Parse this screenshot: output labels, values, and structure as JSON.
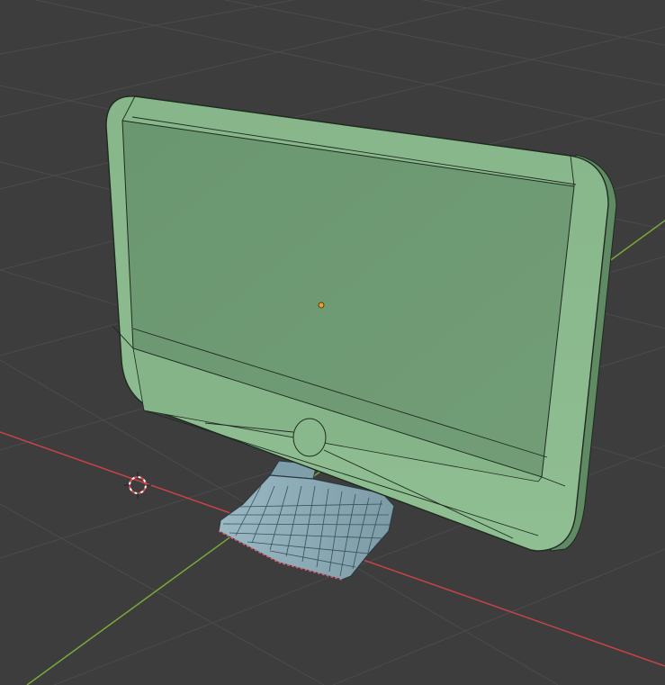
{
  "editor": "3d-viewport",
  "scene": {
    "objects": [
      {
        "name": "monitor-screen",
        "selected": true,
        "highlight_color": "#6e9a72",
        "edge_color": "#1e2a1f"
      },
      {
        "name": "monitor-stand",
        "selected": false,
        "face_color": "#8aa9b4",
        "seam_color": "#e05a6a"
      }
    ],
    "origin_dot_color": "#f0a020",
    "cursor_color": "#e24a4a"
  },
  "grid": {
    "visible": true,
    "x_axis_color": "#c8424a",
    "y_axis_color": "#7ba83a",
    "line_color": "#4a4a4a"
  },
  "colors": {
    "background": "#3d3d3d"
  }
}
